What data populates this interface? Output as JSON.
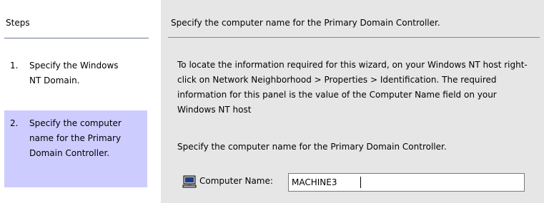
{
  "steps": {
    "header": "Steps",
    "items": [
      {
        "number": "1.",
        "text": "Specify the Windows NT Domain."
      },
      {
        "number": "2.",
        "text": "Specify the computer name for the Primary Domain Controller."
      }
    ]
  },
  "panel": {
    "title": "Specify the computer name for the Primary Domain Controller.",
    "description": "To locate the information required for this wizard, on your Windows NT host right-click on Network Neighborhood > Properties > Identification. The required information for this panel is the value of the Computer Name field on your Windows NT host",
    "instruction": "Specify the computer name for the Primary Domain Controller.",
    "field": {
      "label": "Computer Name:",
      "value": "MACHINE3",
      "icon": "computer-icon"
    }
  },
  "colors": {
    "selected_step_bg": "#ccccff",
    "panel_bg": "#e6e6e6",
    "divider": "#7a85a0"
  }
}
